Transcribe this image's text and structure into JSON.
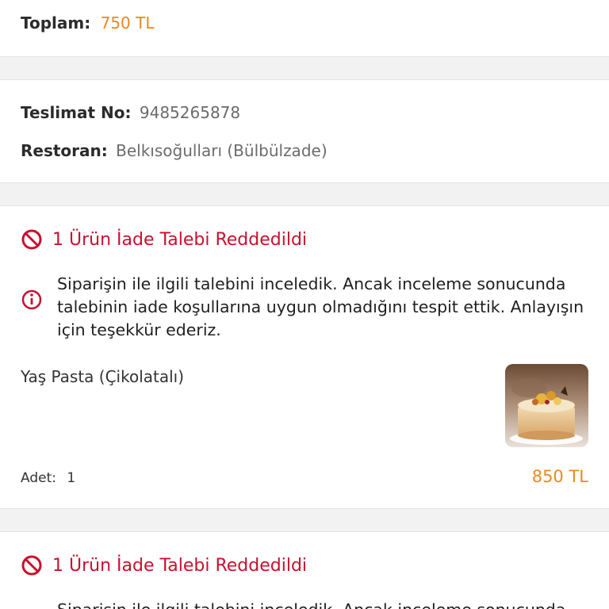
{
  "total": {
    "label": "Toplam:",
    "value": "750 TL"
  },
  "delivery": {
    "no_label": "Teslimat No:",
    "no_value": "9485265878",
    "restaurant_label": "Restoran:",
    "restaurant_value": "Belkısoğulları (Bülbülzade)"
  },
  "refunds": [
    {
      "title": "1 Ürün İade Talebi Reddedildi",
      "message": "Siparişin ile ilgili talebini inceledik. Ancak inceleme sonucunda talebinin iade koşullarına uygun olmadığını tespit ettik. Anlayışın için teşekkür ederiz.",
      "product_name": "Yaş Pasta (Çikolatalı)",
      "qty_label": "Adet:",
      "qty_value": "1",
      "price": "850 TL"
    },
    {
      "title": "1 Ürün İade Talebi Reddedildi",
      "message": "Siparişin ile ilgili talebini inceledik. Ancak inceleme sonucunda"
    }
  ],
  "colors": {
    "accent_orange": "#e8891f",
    "reject_red": "#c8102e",
    "background": "#f2f2f2"
  },
  "icons": {
    "reject": "ban-icon",
    "info": "info-circle-icon",
    "product": "cake-image"
  }
}
